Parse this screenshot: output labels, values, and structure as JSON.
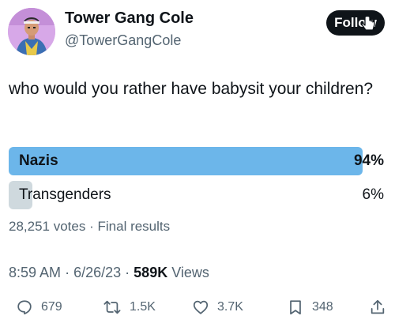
{
  "author": {
    "name": "Tower Gang Cole",
    "handle": "@TowerGangCole"
  },
  "follow_button": {
    "label": "Follow"
  },
  "tweet": {
    "text": "who would you rather have babysit your children?"
  },
  "poll": {
    "options": [
      {
        "label": "Nazis",
        "percent_text": "94%",
        "percent": 94,
        "winner": true
      },
      {
        "label": "Transgenders",
        "percent_text": "6%",
        "percent": 6,
        "winner": false
      }
    ],
    "votes": "28,251 votes",
    "separator": "·",
    "status": "Final results",
    "colors": {
      "winner_bar": "#6cb6ea",
      "loser_bar": "#cfd9de"
    }
  },
  "meta": {
    "time": "8:59 AM",
    "date": "6/26/23",
    "views_count": "589K",
    "views_label": "Views",
    "separator": "·"
  },
  "actions": {
    "reply": {
      "icon": "reply-icon",
      "count": "679"
    },
    "retweet": {
      "icon": "retweet-icon",
      "count": "1.5K"
    },
    "like": {
      "icon": "heart-icon",
      "count": "3.7K"
    },
    "bookmark": {
      "icon": "bookmark-icon",
      "count": "348"
    },
    "share": {
      "icon": "share-icon"
    }
  }
}
